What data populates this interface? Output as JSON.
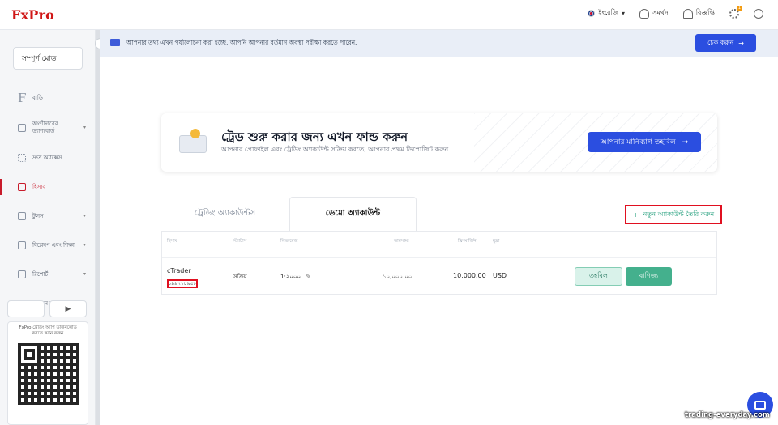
{
  "app": {
    "logo": "FxPro"
  },
  "topbar": {
    "language": "ইংরেজি",
    "language_caret": "▾",
    "support": "সমর্থন",
    "notifications": "বিজ্ঞপ্তি",
    "settings_badge": "1"
  },
  "sidebar": {
    "mode": "সম্পূর্ণ মোড",
    "items": [
      {
        "label": "বাড়ি",
        "icon": "fxpro-f-icon"
      },
      {
        "label": "অংশীদারের ড্যাশবোর্ড",
        "icon": "grid-icon",
        "chevron": "▾"
      },
      {
        "label": "দ্রুত অ্যাক্সেস",
        "icon": "dots-icon"
      },
      {
        "label": "হিসাব",
        "icon": "accounts-icon"
      },
      {
        "label": "টুলস",
        "icon": "sliders-icon",
        "chevron": "▾"
      },
      {
        "label": "বিশ্লেষণ এবং শিক্ষা",
        "icon": "graduation-icon",
        "chevron": "▾"
      },
      {
        "label": "রিপোর্ট",
        "icon": "report-icon",
        "chevron": "▾"
      },
      {
        "label": "বিপণন সম্পদ",
        "icon": "marketing-icon",
        "chevron": "▾"
      }
    ],
    "app_store_icon": "",
    "play_store_icon": "▶",
    "qr_text": "FxPro ট্রেডিং অ্যাপ ডাউনলোড করতে স্ক্যান করুন"
  },
  "collapse_arrow": "‹",
  "banner": {
    "text": "আপনার তথ্য এখন পর্যালোচনা করা হচ্ছে, আপনি আপনার বর্তমান অবস্থা পরীক্ষা করতে পারেন.",
    "button_label": "চেক করুন",
    "arrow": "→"
  },
  "fund_card": {
    "title": "ট্রেড শুরু করার জন্য এখন ফান্ড করুন",
    "subtitle": "আপনার প্রোফাইল এবং ট্রেডিং অ্যাকাউন্ট সক্রিয় করতে, আপনার প্রথম ডিপোজিট করুন",
    "button_label": "আপনার মানিব্যাগ তহবিল",
    "arrow": "→"
  },
  "tabs": {
    "trading": "ট্রেডিং অ্যাকাউন্টস",
    "demo": "ডেমো অ্যাকাউন্ট"
  },
  "new_account": {
    "plus": "+",
    "label": "নতুন অ্যাকাউন্ট তৈরি করুন"
  },
  "table": {
    "headers": [
      "হিসাব",
      "স্ট্যাটাস",
      "লিভারেজ",
      "ভারসাম্য",
      "ফ্রি মার্জিন",
      "মুদ্রা"
    ],
    "row": {
      "platform": "cTrader",
      "account_id": "১৯৯৭১৮৯৫৮",
      "status": "সক্রিয়",
      "leverage": "1:২০০০",
      "balance": "১০,০০০.০০",
      "free_margin": "10,000.00",
      "currency": "USD",
      "deposit_label": "তহবিল",
      "trade_label": "বাণিজ্য"
    }
  },
  "watermark": "trading-everyday.com"
}
